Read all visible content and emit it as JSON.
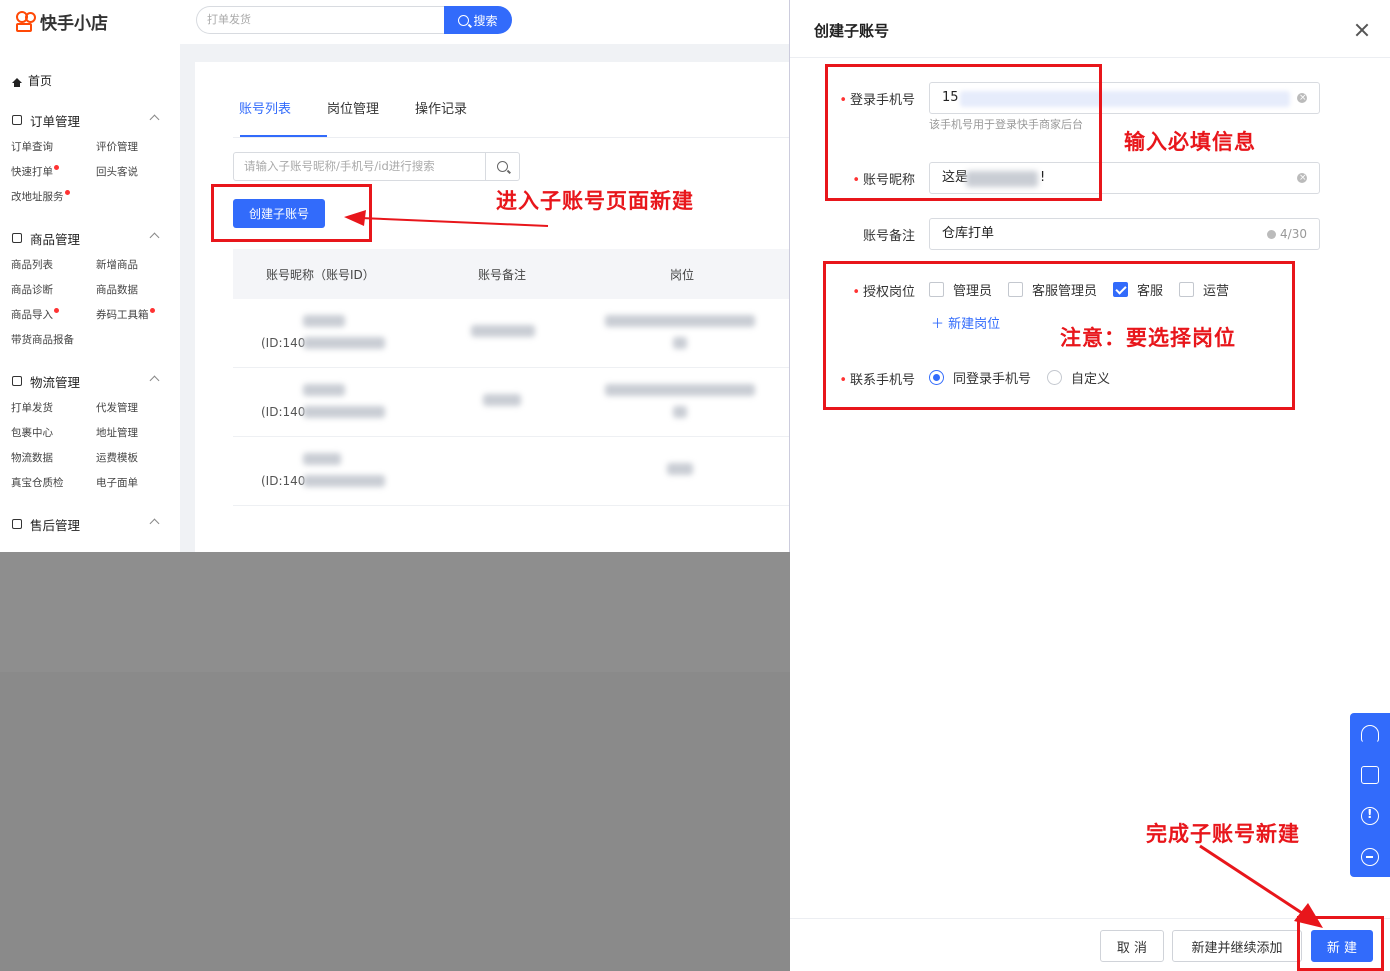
{
  "app": {
    "logo_text": "快手小店",
    "search_placeholder": "打单发货",
    "search_button": "搜索",
    "colors": {
      "brand": "#ff4906",
      "accent": "#326bfb",
      "annotation": "#e8161b"
    }
  },
  "sidebar": {
    "home": "首页",
    "sections": [
      {
        "title": "订单管理",
        "icon": "order-icon",
        "items": [
          {
            "label": "订单查询",
            "dot": false
          },
          {
            "label": "评价管理",
            "dot": false
          },
          {
            "label": "快速打单",
            "dot": true
          },
          {
            "label": "回头客说",
            "dot": false
          },
          {
            "label": "改地址服务",
            "dot": true
          }
        ]
      },
      {
        "title": "商品管理",
        "icon": "goods-icon",
        "items": [
          {
            "label": "商品列表",
            "dot": false
          },
          {
            "label": "新增商品",
            "dot": false
          },
          {
            "label": "商品诊断",
            "dot": false
          },
          {
            "label": "商品数据",
            "dot": false
          },
          {
            "label": "商品导入",
            "dot": true
          },
          {
            "label": "券码工具箱",
            "dot": true
          },
          {
            "label": "带货商品报备",
            "dot": false
          }
        ]
      },
      {
        "title": "物流管理",
        "icon": "truck-icon",
        "items": [
          {
            "label": "打单发货",
            "dot": false
          },
          {
            "label": "代发管理",
            "dot": false
          },
          {
            "label": "包裹中心",
            "dot": false
          },
          {
            "label": "地址管理",
            "dot": false
          },
          {
            "label": "物流数据",
            "dot": false
          },
          {
            "label": "运费模板",
            "dot": false
          },
          {
            "label": "真宝仓质检",
            "dot": false
          },
          {
            "label": "电子面单",
            "dot": false
          }
        ]
      },
      {
        "title": "售后管理",
        "icon": "shield-icon",
        "items": []
      }
    ]
  },
  "content": {
    "tabs": [
      "账号列表",
      "岗位管理",
      "操作记录"
    ],
    "search_placeholder": "请输入子账号昵称/手机号/id进行搜索",
    "create_button": "创建子账号",
    "table_headers": [
      "账号昵称（账号ID）",
      "账号备注",
      "岗位"
    ],
    "rows": [
      {
        "id_prefix": "(ID:140"
      },
      {
        "id_prefix": "(ID:140"
      },
      {
        "id_prefix": "(ID:140"
      }
    ]
  },
  "drawer": {
    "title": "创建子账号",
    "phone_label": "登录手机号",
    "phone_value": "15",
    "phone_hint": "该手机号用于登录快手商家后台",
    "nickname_label": "账号昵称",
    "nickname_prefix": "这是",
    "nickname_suffix": "!",
    "remark_label": "账号备注",
    "remark_value": "仓库打单",
    "remark_count": "4/30",
    "role_label": "授权岗位",
    "roles": [
      {
        "label": "管理员",
        "checked": false
      },
      {
        "label": "客服管理员",
        "checked": false
      },
      {
        "label": "客服",
        "checked": true
      },
      {
        "label": "运营",
        "checked": false
      }
    ],
    "new_role": "新建岗位",
    "contact_label": "联系手机号",
    "contact_options": [
      {
        "label": "同登录手机号",
        "selected": true
      },
      {
        "label": "自定义",
        "selected": false
      }
    ],
    "cancel_button": "取 消",
    "continue_button": "新建并继续添加",
    "submit_button": "新 建"
  },
  "annotations": {
    "enter_page": "进入子账号页面新建",
    "fill_required": "输入必填信息",
    "note_role": "注意：要选择岗位",
    "finish": "完成子账号新建"
  }
}
